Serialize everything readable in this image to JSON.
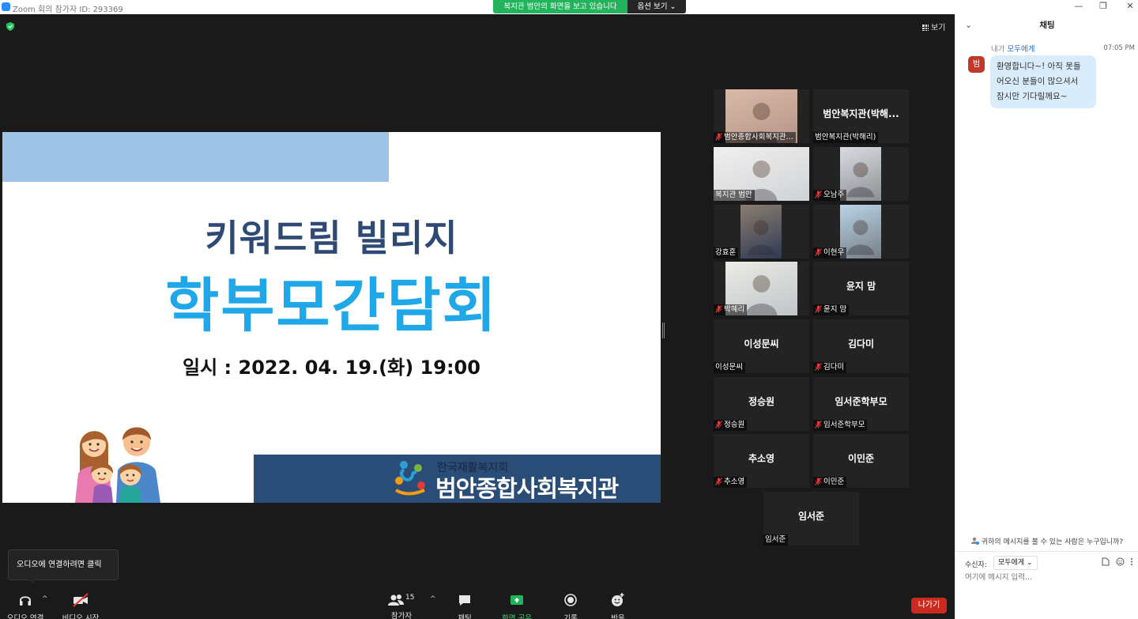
{
  "window": {
    "title": "Zoom 회의 참가자 ID: 293369",
    "share_banner": "복지관 범안의 화면을 보고 있습니다",
    "view_options": "옵션 보기 ⌄",
    "minimize": "—",
    "restore": "❐",
    "close": "✕"
  },
  "meeting": {
    "view_label": "보기",
    "divider_handle": "||"
  },
  "slide": {
    "subtitle": "키워드림 빌리지",
    "title": "학부모간담회",
    "datetime": "일시 : 2022. 04. 19.(화) 19:00",
    "org_sub": "한국재활복지회",
    "org_name": "범안종합사회복지관"
  },
  "participants": [
    {
      "name": "범안종합사회복지관...",
      "display": "",
      "muted": true,
      "video": true
    },
    {
      "name": "범안복지관(박해리)",
      "display": "범안복지관(박해...",
      "muted": false,
      "video": false
    },
    {
      "name": "복지관 범안",
      "display": "",
      "muted": false,
      "video": true,
      "active": true
    },
    {
      "name": "오남주",
      "display": "",
      "muted": true,
      "video": true
    },
    {
      "name": "강효훈",
      "display": "",
      "muted": false,
      "video": true
    },
    {
      "name": "이현우",
      "display": "",
      "muted": true,
      "video": true
    },
    {
      "name": "박혜리",
      "display": "",
      "muted": true,
      "video": true
    },
    {
      "name": "윤지 맘",
      "display": "윤지 맘",
      "muted": true,
      "video": false
    },
    {
      "name": "이성문씨",
      "display": "이성문씨",
      "muted": false,
      "video": false
    },
    {
      "name": "김다미",
      "display": "김다미",
      "muted": true,
      "video": false
    },
    {
      "name": "정승원",
      "display": "정승원",
      "muted": true,
      "video": false
    },
    {
      "name": "임서준학부모",
      "display": "임서준학부모",
      "muted": true,
      "video": false
    },
    {
      "name": "추소영",
      "display": "추소영",
      "muted": true,
      "video": false
    },
    {
      "name": "이민준",
      "display": "이민준",
      "muted": true,
      "video": false
    },
    {
      "name": "임서준",
      "display": "임서준",
      "muted": false,
      "video": false
    }
  ],
  "toolbar": {
    "audio": "오디오 연결",
    "video": "비디오 시작",
    "participants": "참가자",
    "participant_count": "15",
    "chat": "채팅",
    "share": "화면 공유",
    "record": "기록",
    "reactions": "반응",
    "leave": "나가기",
    "audio_tooltip": "오디오에 연결하려면 클릭",
    "caret": "^"
  },
  "chat": {
    "title": "채팅",
    "collapse": "⌄",
    "sender_prefix": "내가",
    "recipient": "모두에게",
    "time": "07:05 PM",
    "avatar": "범",
    "message_lines": [
      "환영합니다~! 아직 못들",
      "어오신 분들이 많으셔서",
      "잠시만 기다릴께요~"
    ],
    "who_can_see": "귀하의 메시지를 볼 수 있는 사람은 누구입니까?",
    "to_label": "수신자:",
    "to_value": "모두에게 ⌄",
    "input_placeholder": "여기에 메시지 입력..."
  },
  "colors": {
    "accent": "#2d8cff",
    "share_green": "#22b35c",
    "leave_red": "#cc2a1f",
    "slide_blue": "#1fa7e8",
    "slide_navy": "#2e4a74"
  }
}
